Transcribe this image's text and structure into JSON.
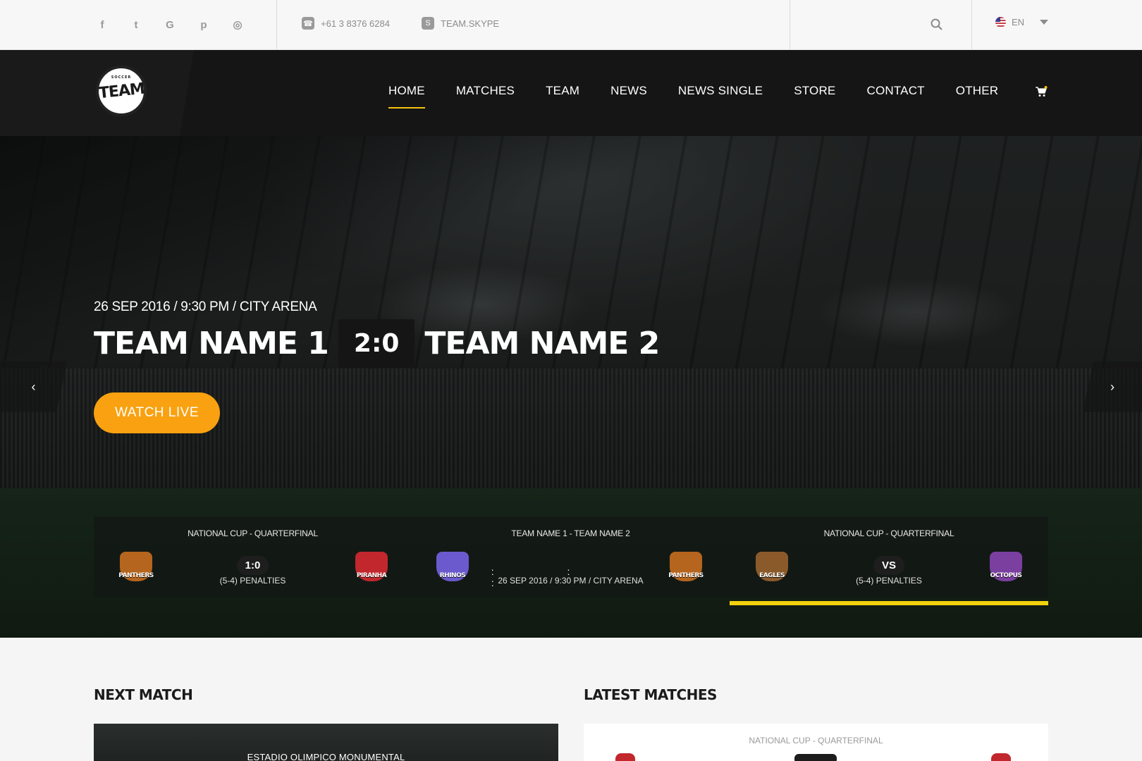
{
  "topbar": {
    "social": [
      {
        "icon": "facebook-icon",
        "glyph": "f"
      },
      {
        "icon": "twitter-icon",
        "glyph": "t"
      },
      {
        "icon": "google-icon",
        "glyph": "G"
      },
      {
        "icon": "pinterest-icon",
        "glyph": "p"
      },
      {
        "icon": "instagram-icon",
        "glyph": "◎"
      }
    ],
    "phone": "+61 3 8376 6284",
    "skype": "TEAM.SKYPE",
    "language": "EN"
  },
  "header": {
    "logo_text": "TEAM",
    "logo_subtext": "SOCCER",
    "nav": [
      "HOME",
      "MATCHES",
      "TEAM",
      "NEWS",
      "NEWS SINGLE",
      "STORE",
      "CONTACT",
      "OTHER"
    ],
    "active_nav": "HOME"
  },
  "hero": {
    "meta": "26 SEP 2016 / 9:30 PM / CITY ARENA",
    "team1": "TEAM NAME 1",
    "score": "2:0",
    "team2": "TEAM NAME 2",
    "cta": "WATCH LIVE",
    "prev": "‹",
    "next": "›"
  },
  "ticker": [
    {
      "title": "NATIONAL CUP - QUARTERFINAL",
      "home": "PANTHERS",
      "away": "PIRANHA",
      "score": "1:0",
      "sub": "(5-4) PENALTIES"
    },
    {
      "title": "TEAM NAME 1 - TEAM NAME 2",
      "home": "RHINOS",
      "away": "PANTHERS",
      "score": ": : :",
      "sub": "26 SEP 2016 / 9:30 PM / CITY ARENA"
    },
    {
      "title": "NATIONAL CUP - QUARTERFINAL",
      "home": "EAGLES",
      "away": "OCTOPUS",
      "score": "VS",
      "sub": "(5-4) PENALTIES"
    }
  ],
  "sections": {
    "next_match": "NEXT MATCH",
    "next_match_venue": "ESTADIO OLIMPICO MONUMENTAL",
    "latest_matches": "LATEST MATCHES",
    "latest_title": "NATIONAL CUP - QUARTERFINAL"
  },
  "colors": {
    "accent": "#f9a110",
    "progress": "#f4d20d",
    "nav_underline": "#f4c20d",
    "header_bg": "#151515",
    "panthers": "#b5651d",
    "piranha": "#c1272d",
    "rhinos": "#6a5acd",
    "eagles": "#8b5a2b",
    "octopus": "#7b3fa0"
  }
}
